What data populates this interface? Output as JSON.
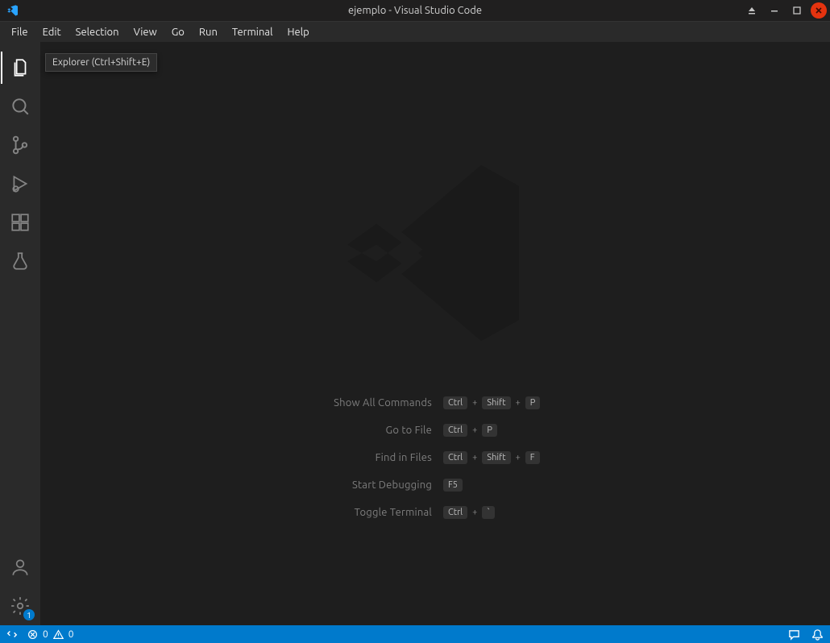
{
  "titlebar": {
    "title": "ejemplo - Visual Studio Code"
  },
  "menubar": [
    "File",
    "Edit",
    "Selection",
    "View",
    "Go",
    "Run",
    "Terminal",
    "Help"
  ],
  "activity": {
    "explorer_tooltip": "Explorer (Ctrl+Shift+E)",
    "settings_badge": "1"
  },
  "shortcuts": [
    {
      "label": "Show All Commands",
      "keys": [
        "Ctrl",
        "+",
        "Shift",
        "+",
        "P"
      ]
    },
    {
      "label": "Go to File",
      "keys": [
        "Ctrl",
        "+",
        "P"
      ]
    },
    {
      "label": "Find in Files",
      "keys": [
        "Ctrl",
        "+",
        "Shift",
        "+",
        "F"
      ]
    },
    {
      "label": "Start Debugging",
      "keys": [
        "F5"
      ]
    },
    {
      "label": "Toggle Terminal",
      "keys": [
        "Ctrl",
        "+",
        "`"
      ]
    }
  ],
  "statusbar": {
    "errors": "0",
    "warnings": "0"
  }
}
